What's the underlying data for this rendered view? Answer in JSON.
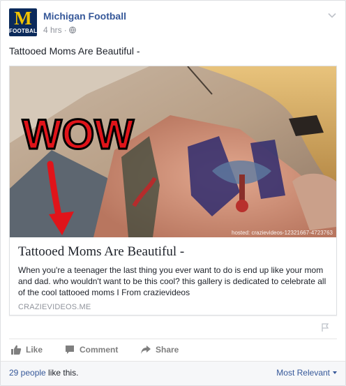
{
  "post": {
    "page_name": "Michigan Football",
    "timestamp": "4 hrs",
    "separator": "·",
    "privacy_icon": "globe-icon",
    "text": "Tattooed Moms Are Beautiful -",
    "logo": {
      "letter": "M",
      "word": "FOOTBALL"
    }
  },
  "link": {
    "watermark": "hosted: crazievideos-12321667-4723763",
    "overlay_word": "WOW",
    "title": "Tattooed Moms Are Beautiful -",
    "description": "When you're a teenager the last thing you ever want to do is end up like your mom and dad. who wouldn't want to be this cool? this gallery is dedicated to celebrate all of the cool tattooed moms I From crazievideos",
    "domain": "CRAZIEVIDEOS.ME"
  },
  "actions": {
    "like": "Like",
    "comment": "Comment",
    "share": "Share"
  },
  "footer": {
    "like_count": "29 people",
    "like_suffix": " like this.",
    "sort": "Most Relevant"
  },
  "colors": {
    "brand_link": "#365899",
    "logo_blue": "#0b2a5b",
    "logo_maize": "#f2c300",
    "overlay_red": "#e0141a"
  }
}
